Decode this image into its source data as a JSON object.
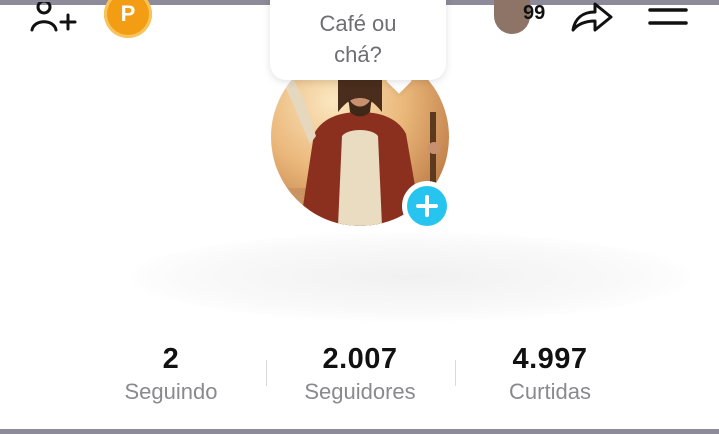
{
  "header": {
    "promote_letter": "P",
    "inbox_count": "99"
  },
  "profile": {
    "note": [
      "Café ou",
      "chá?"
    ]
  },
  "stats": [
    {
      "value": "2",
      "label": "Seguindo"
    },
    {
      "value": "2.007",
      "label": "Seguidores"
    },
    {
      "value": "4.997",
      "label": "Curtidas"
    }
  ],
  "colors": {
    "accent": "#28c4f0",
    "promote": "#f39d14"
  }
}
